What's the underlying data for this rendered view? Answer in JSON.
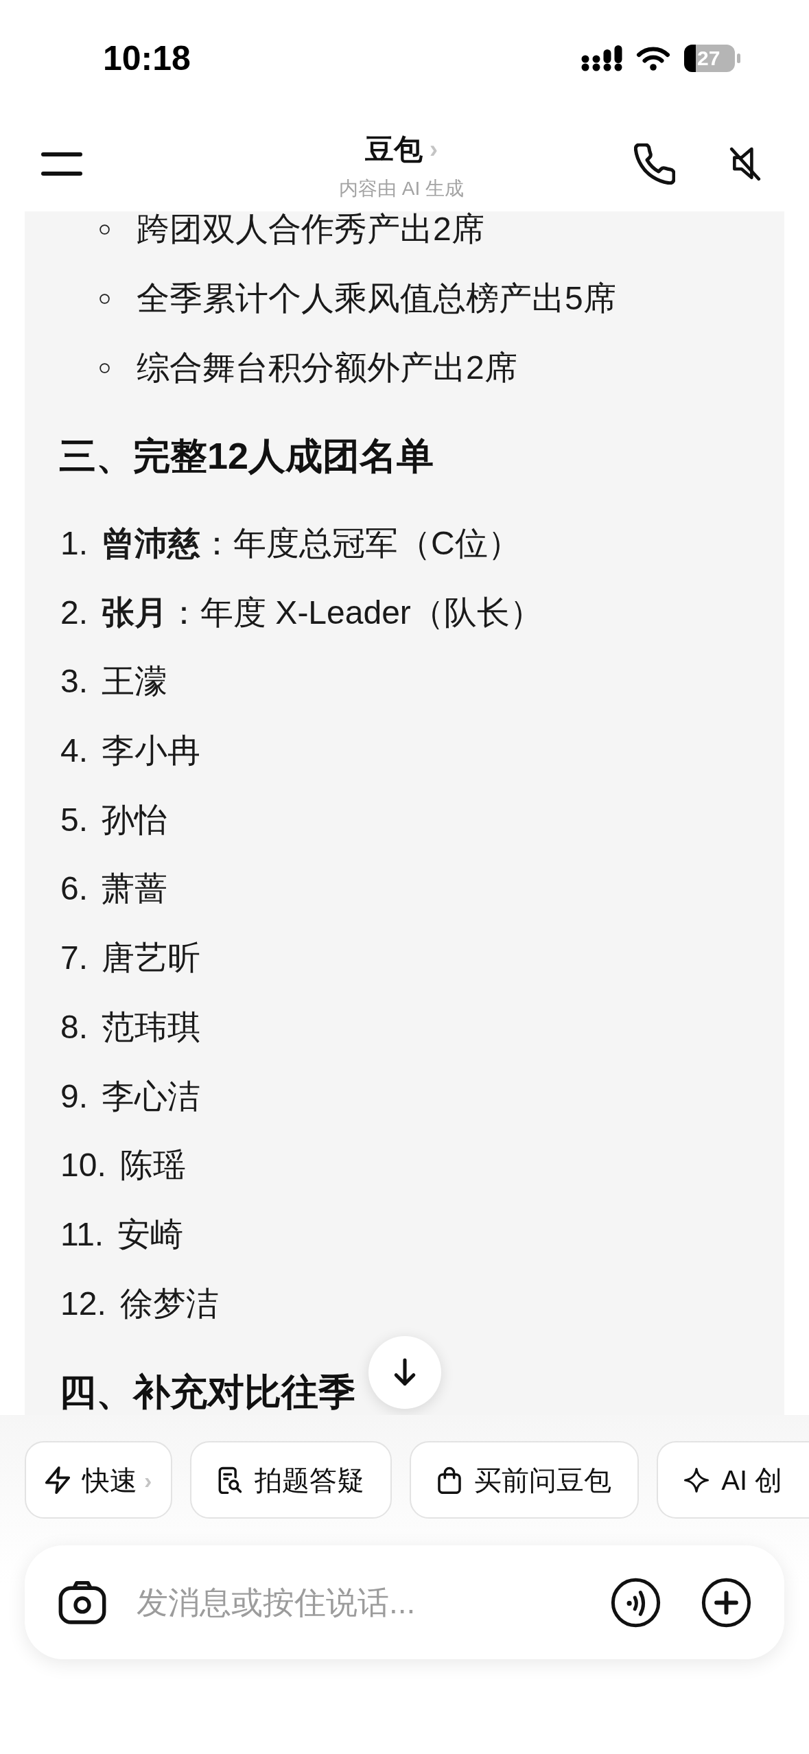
{
  "status_bar": {
    "time": "10:18",
    "battery": "27"
  },
  "header": {
    "title": "豆包",
    "chevron": "›",
    "subtitle": "内容由 AI 生成"
  },
  "message": {
    "blocks": [
      {
        "kind": "bullets",
        "items": [
          "跨团双人合作秀产出2席",
          "全季累计个人乘风值总榜产出5席",
          "综合舞台积分额外产出2席"
        ]
      },
      {
        "kind": "heading",
        "text": "三、完整12人成团名单"
      },
      {
        "kind": "numbered",
        "items": [
          {
            "number": "1.",
            "text": "**曾沛慈**：年度总冠军（C位）"
          },
          {
            "number": "2.",
            "text": "**张月**：年度 X-Leader（队长）"
          },
          {
            "number": "3.",
            "text": "王濛"
          },
          {
            "number": "4.",
            "text": "李小冉"
          },
          {
            "number": "5.",
            "text": "孙怡"
          },
          {
            "number": "6.",
            "text": "萧蔷"
          },
          {
            "number": "7.",
            "text": "唐艺昕"
          },
          {
            "number": "8.",
            "text": "范玮琪"
          },
          {
            "number": "9.",
            "text": "李心洁"
          },
          {
            "number": "10.",
            "text": "陈瑶"
          },
          {
            "number": "11.",
            "text": "安崎"
          },
          {
            "number": "12.",
            "text": "徐梦洁"
          }
        ]
      },
      {
        "kind": "heading",
        "text": "四、补充对比往季"
      }
    ]
  },
  "chips": [
    {
      "kind": "mode",
      "label": "快速",
      "chevron": "›"
    },
    {
      "kind": "photo_qa",
      "label": "拍题答疑"
    },
    {
      "kind": "shopping",
      "label": "买前问豆包"
    },
    {
      "kind": "creation",
      "label": "AI 创"
    }
  ],
  "composer": {
    "placeholder": "发消息或按住说话..."
  }
}
